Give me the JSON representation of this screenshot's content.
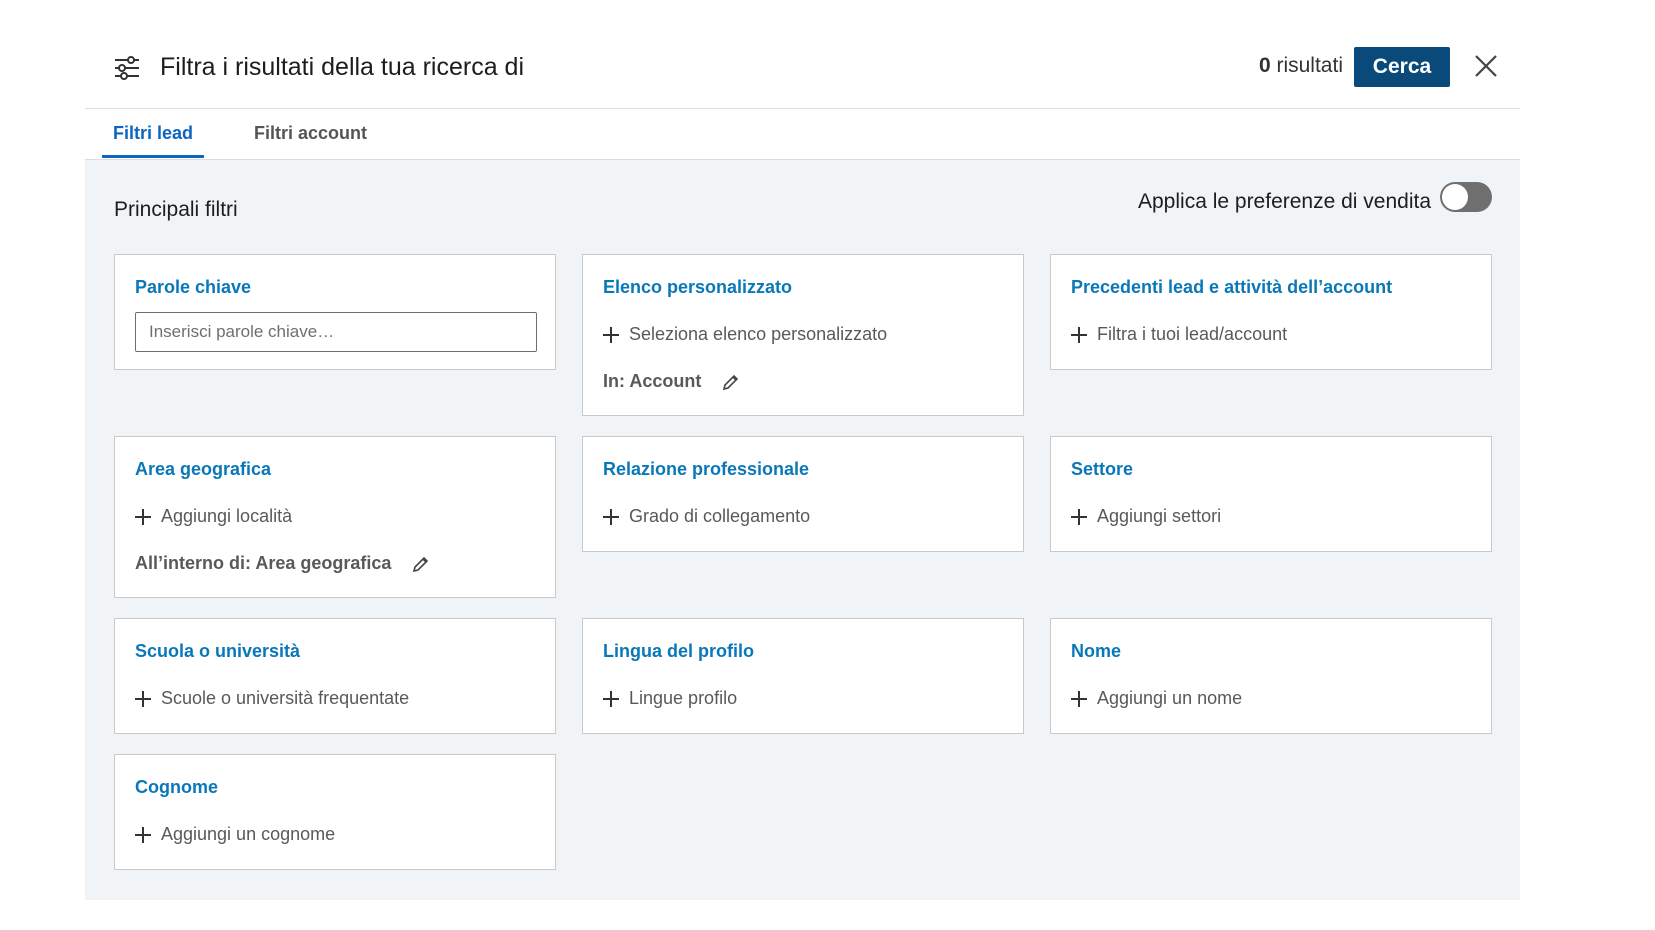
{
  "header": {
    "title": "Filtra i risultati della tua ricerca di",
    "results_count": "0",
    "results_label": "risultati",
    "search_button": "Cerca"
  },
  "tabs": [
    {
      "label": "Filtri lead",
      "active": true
    },
    {
      "label": "Filtri account",
      "active": false
    }
  ],
  "panel": {
    "section_title": "Principali filtri",
    "preferences_label": "Applica le preferenze di vendita",
    "preferences_enabled": false
  },
  "cards": {
    "keywords": {
      "title": "Parole chiave",
      "placeholder": "Inserisci parole chiave…"
    },
    "custom_list": {
      "title": "Elenco personalizzato",
      "add": "Seleziona elenco personalizzato",
      "scope": "In: Account"
    },
    "past_activity": {
      "title": "Precedenti lead e attività dell’account",
      "add": "Filtra i tuoi lead/account"
    },
    "geography": {
      "title": "Area geografica",
      "add": "Aggiungi località",
      "scope": "All’interno di: Area geografica"
    },
    "relationship": {
      "title": "Relazione professionale",
      "add": "Grado di collegamento"
    },
    "industry": {
      "title": "Settore",
      "add": "Aggiungi settori"
    },
    "school": {
      "title": "Scuola o università",
      "add": "Scuole o università frequentate"
    },
    "profile_language": {
      "title": "Lingua del profilo",
      "add": "Lingue profilo"
    },
    "first_name": {
      "title": "Nome",
      "add": "Aggiungi un nome"
    },
    "last_name": {
      "title": "Cognome",
      "add": "Aggiungi un cognome"
    }
  },
  "colors": {
    "accent": "#0a66c2",
    "button": "#0a4a7a",
    "panel_bg": "#f1f4f7"
  }
}
